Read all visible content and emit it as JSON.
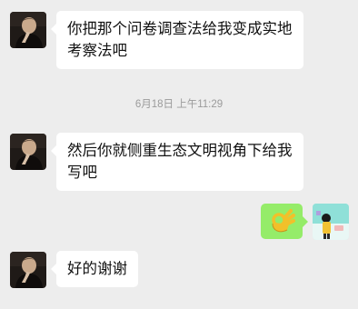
{
  "messages": [
    {
      "sender": "contact",
      "text": "你把那个问卷调查法给我变成实地考察法吧"
    },
    {
      "sender": "contact",
      "text": "然后你就侧重生态文明视角下给我写吧"
    },
    {
      "sender": "self",
      "type": "emoji",
      "icon": "ok-hand-icon"
    },
    {
      "sender": "contact",
      "text": "好的谢谢"
    }
  ],
  "timestamp": "6月18日 上午11:29",
  "colors": {
    "background": "#ededed",
    "incoming_bubble": "#ffffff",
    "outgoing_bubble": "#95ec69",
    "timestamp_text": "#9b9b9b"
  }
}
